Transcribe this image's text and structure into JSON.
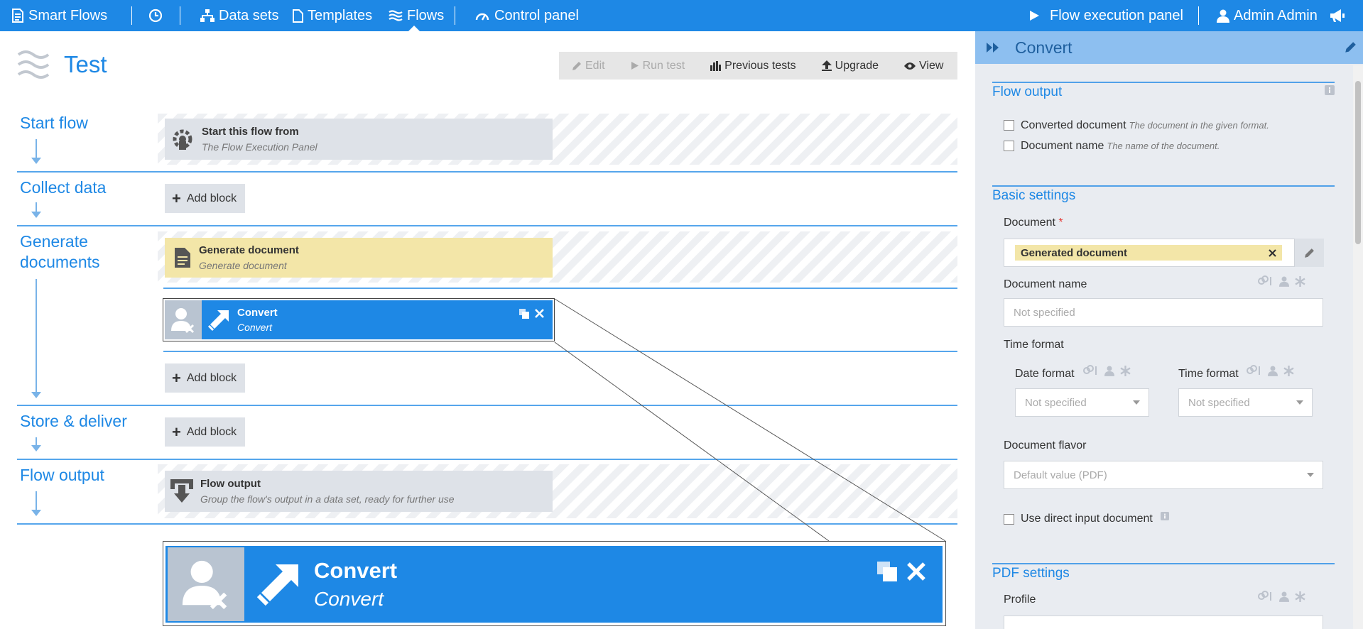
{
  "nav": {
    "brand": "Smart Flows",
    "datasets": "Data sets",
    "templates": "Templates",
    "flows": "Flows",
    "control_panel": "Control panel",
    "flow_execution_panel": "Flow execution panel",
    "user": "Admin Admin"
  },
  "page": {
    "title": "Test",
    "toolbar": {
      "edit": "Edit",
      "run_test": "Run test",
      "previous_tests": "Previous tests",
      "upgrade": "Upgrade",
      "view": "View"
    }
  },
  "sections": {
    "start_flow": "Start flow",
    "collect_data": "Collect data",
    "generate_documents": "Generate documents",
    "store_deliver": "Store & deliver",
    "flow_output": "Flow output"
  },
  "blocks": {
    "start": {
      "title": "Start this flow from",
      "subtitle": "The Flow Execution Panel"
    },
    "generate": {
      "title": "Generate document",
      "subtitle": "Generate document"
    },
    "convert": {
      "title": "Convert",
      "subtitle": "Convert"
    },
    "output": {
      "title": "Flow output",
      "subtitle": "Group the flow's output in a data set, ready for further use"
    },
    "add_block": "Add block"
  },
  "zoom": {
    "title": "Convert",
    "subtitle": "Convert"
  },
  "panel": {
    "title": "Convert",
    "flow_output": {
      "heading": "Flow output",
      "items": [
        {
          "label": "Converted document",
          "desc": "The document in the given format."
        },
        {
          "label": "Document name",
          "desc": "The name of the document."
        }
      ]
    },
    "basic": {
      "heading": "Basic settings",
      "document_label": "Document",
      "required_mark": "*",
      "document_value": "Generated document",
      "document_name_label": "Document name",
      "document_name_placeholder": "Not specified",
      "time_format_label": "Time format",
      "date_format_label": "Date format",
      "date_format_value": "Not specified",
      "time_format_sub_label": "Time format",
      "time_format_value": "Not specified",
      "flavor_label": "Document flavor",
      "flavor_value": "Default value (PDF)",
      "direct_input_label": "Use direct input document"
    },
    "pdf": {
      "heading": "PDF settings",
      "profile_label": "Profile"
    }
  },
  "colors": {
    "accent": "#1e88e5",
    "panel_bg": "#e9ecf1",
    "generate_block": "#f3e6a8",
    "block_gray": "#dee2e8"
  }
}
